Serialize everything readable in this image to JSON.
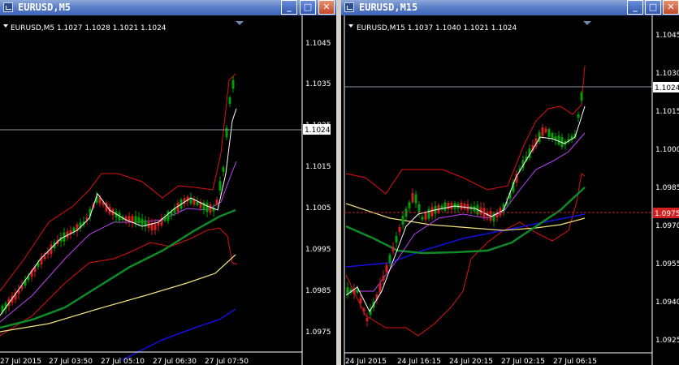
{
  "windows": [
    {
      "title": "EURUSD,M5",
      "header": "EURUSD,M5  1.1027 1.1028 1.1021 1.1024",
      "bid_label": "1.1024",
      "price_ticks": [
        "1.1045",
        "1.1035",
        "1.1025",
        "1.1015",
        "1.1005",
        "1.0995",
        "1.0985",
        "1.0975"
      ],
      "time_ticks": [
        "27 Jul 2015",
        "27 Jul 03:50",
        "27 Jul 05:10",
        "27 Jul 06:30",
        "27 Jul 07:50"
      ],
      "buttons": {
        "minimize": "_",
        "maximize": "□",
        "close": "✕"
      }
    },
    {
      "title": "EURUSD,M15",
      "header": "EURUSD,M15  1.1037 1.1040 1.1021 1.1024",
      "bid_label": "1.1024",
      "alert_label": "1.0975",
      "price_ticks": [
        "1.1045",
        "1.1030",
        "1.1015",
        "1.1000",
        "1.0985",
        "1.0970",
        "1.0955",
        "1.0940",
        "1.0925"
      ],
      "time_ticks": [
        "24 Jul 2015",
        "24 Jul 16:15",
        "24 Jul 20:15",
        "27 Jul 02:15",
        "27 Jul 06:15"
      ],
      "buttons": {
        "minimize": "_",
        "maximize": "□",
        "close": "✕"
      }
    }
  ],
  "colors": {
    "bull_candle": "#00a000",
    "bear_candle": "#d02020",
    "bollinger": "#e01010",
    "ma_green": "#0e8a28",
    "ma_yellow": "#f0e080",
    "ma_blue": "#1010e0",
    "ma_white": "#ffffff",
    "ma_violet": "#c040ff",
    "price_line": "#8899aa",
    "alert_line": "#d02020"
  }
}
